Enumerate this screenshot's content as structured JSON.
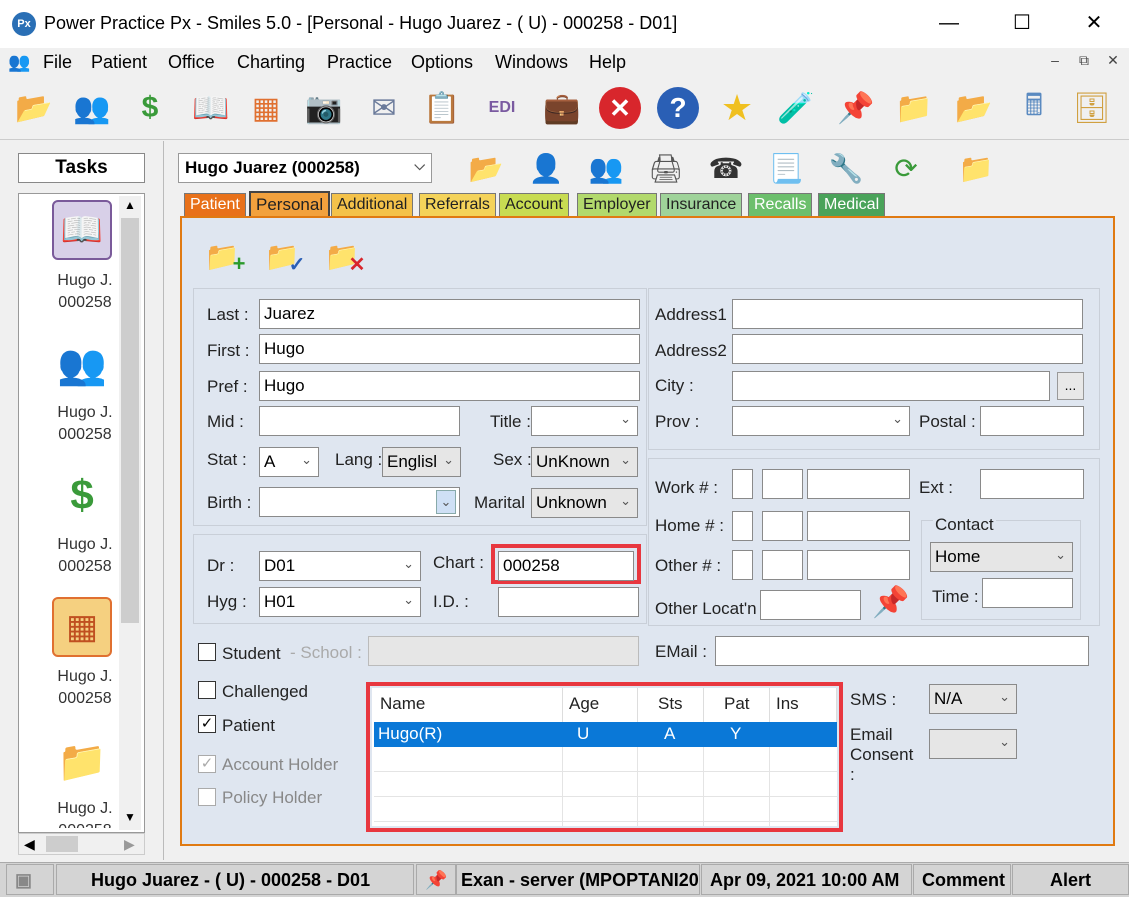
{
  "window": {
    "title": "Power Practice Px - Smiles 5.0 - [Personal - Hugo Juarez - ( U) - 000258 - D01]",
    "app_icon": "Px"
  },
  "menu": {
    "items": [
      {
        "label": "File"
      },
      {
        "label": "Patient"
      },
      {
        "label": "Office"
      },
      {
        "label": "Charting"
      },
      {
        "label": "Practice"
      },
      {
        "label": "Options"
      },
      {
        "label": "Windows"
      },
      {
        "label": "Help"
      }
    ]
  },
  "toolbar": {
    "icons": [
      "folder-open-icon",
      "patients-icon",
      "money-icon",
      "book-icon",
      "chart-icon",
      "camera-icon",
      "mail-icon",
      "notepad-icon",
      "edi-icon",
      "toolbox-icon",
      "close-icon",
      "help-icon",
      "star-icon",
      "bottle-icon",
      "pin-icon",
      "folder-doc-icon",
      "folder-face-icon",
      "calculator-icon",
      "folder-copy-icon"
    ]
  },
  "tasks": {
    "header": "Tasks",
    "items": [
      {
        "name": "Hugo J.",
        "id": "000258"
      },
      {
        "name": "Hugo J.",
        "id": "000258"
      },
      {
        "name": "Hugo J.",
        "id": "000258"
      },
      {
        "name": "Hugo J.",
        "id": "000258"
      },
      {
        "name": "Hugo J.",
        "id": "000258"
      }
    ]
  },
  "patient_select": {
    "value": "Hugo Juarez (000258)"
  },
  "tabs": [
    {
      "label": "Patient",
      "color": "#e8711a"
    },
    {
      "label": "Personal",
      "color": "#f2a13d"
    },
    {
      "label": "Additional",
      "color": "#f4c24a"
    },
    {
      "label": "Referrals",
      "color": "#f4d35a"
    },
    {
      "label": "Account",
      "color": "#c8dc52"
    },
    {
      "label": "Employer",
      "color": "#b2d96c"
    },
    {
      "label": "Insurance",
      "color": "#9fd39a"
    },
    {
      "label": "Recalls",
      "color": "#6cbf6c"
    },
    {
      "label": "Medical",
      "color": "#4aa35a"
    }
  ],
  "form": {
    "last_label": "Last :",
    "last": "Juarez",
    "first_label": "First :",
    "first": "Hugo",
    "pref_label": "Pref :",
    "pref": "Hugo",
    "mid_label": "Mid :",
    "mid": "",
    "title_label": "Title :",
    "title": "",
    "stat_label": "Stat :",
    "stat": "A",
    "lang_label": "Lang :",
    "lang": "Englisl",
    "sex_label": "Sex :",
    "sex": "UnKnown",
    "birth_label": "Birth :",
    "birth": "",
    "marital_label": "Marital :",
    "marital": "Unknown",
    "dr_label": "Dr :",
    "dr": "D01",
    "chart_label": "Chart :",
    "chart": "000258",
    "hyg_label": "Hyg :",
    "hyg": "H01",
    "id_label": "I.D. :",
    "id": "",
    "address1_label": "Address1 :",
    "address1": "",
    "address2_label": "Address2 :",
    "address2": "",
    "city_label": "City :",
    "city": "",
    "city_btn": "...",
    "prov_label": "Prov :",
    "prov": "",
    "postal_label": "Postal :",
    "postal": "",
    "work_label": "Work # :",
    "ext_label": "Ext :",
    "home_label": "Home # :",
    "other_label": "Other # :",
    "other_locat_label": "Other Locat'n :",
    "contact_label": "Contact",
    "contact": "Home",
    "time_label": "Time :",
    "student_label": "Student",
    "school_label": "- School :",
    "email_label": "EMail :",
    "email": "",
    "challenged_label": "Challenged",
    "patient_label": "Patient",
    "account_holder_label": "Account Holder",
    "policy_holder_label": "Policy Holder",
    "sms_label": "SMS :",
    "sms": "N/A",
    "email_consent_label": "Email Consent :",
    "email_consent": ""
  },
  "family_grid": {
    "columns": [
      "Name",
      "Age",
      "Sts",
      "Pat",
      "Ins"
    ],
    "rows": [
      {
        "Name": "Hugo(R)",
        "Age": "U",
        "Sts": "A",
        "Pat": "Y",
        "Ins": ""
      }
    ]
  },
  "statusbar": {
    "patient": "Hugo Juarez - ( U) - 000258 - D01",
    "user": "Exan - server (MPOPTANI20",
    "datetime": "Apr 09, 2021 10:00 AM",
    "comment": "Comment",
    "alert": "Alert"
  }
}
